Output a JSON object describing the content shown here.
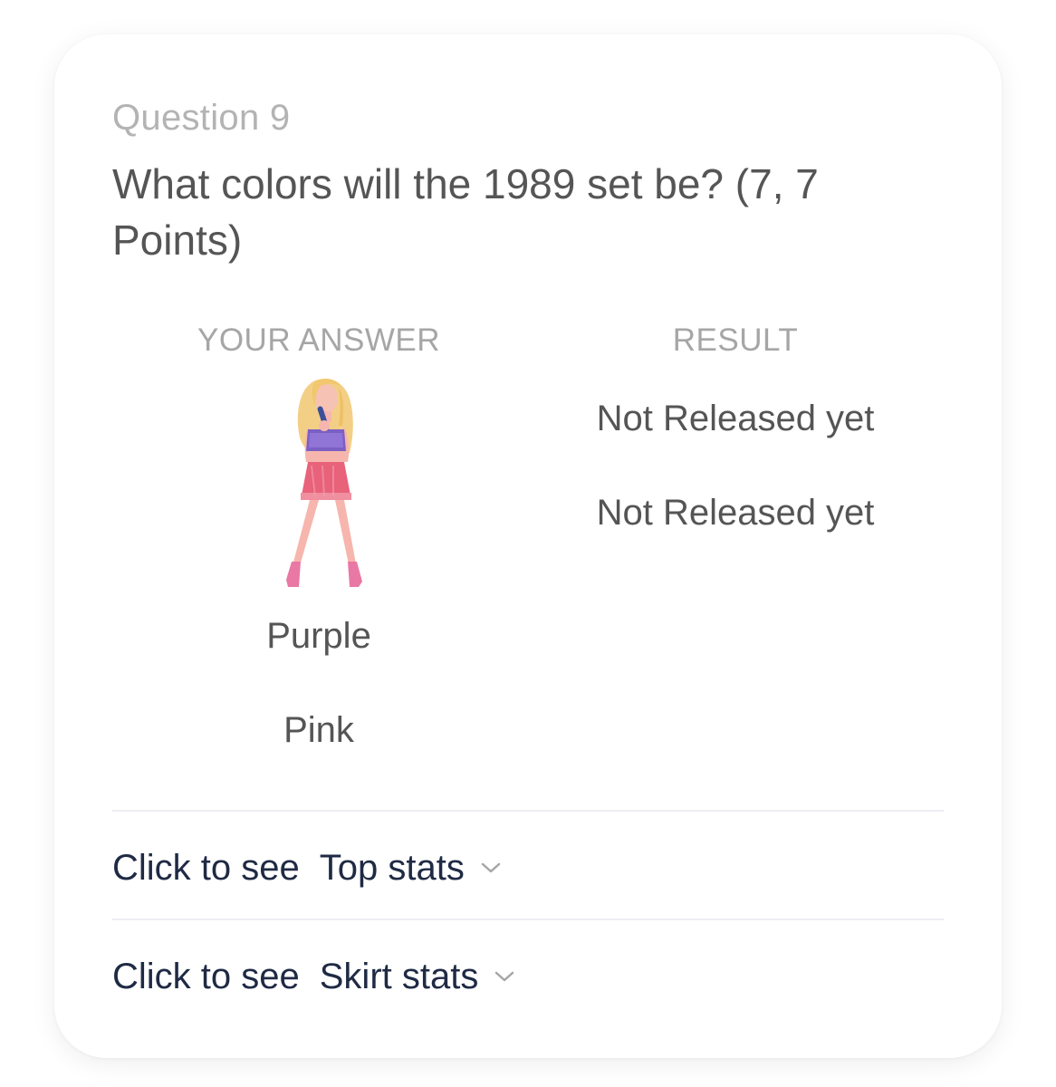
{
  "question": {
    "number_label": "Question 9",
    "text": "What colors will the 1989 set be? (7, 7 Points)"
  },
  "columns": {
    "answer_header": "YOUR ANSWER",
    "result_header": "RESULT"
  },
  "answers": [
    "Purple",
    "Pink"
  ],
  "results": [
    "Not Released yet",
    "Not Released yet"
  ],
  "stats": [
    {
      "prefix": "Click to see",
      "label": "Top stats",
      "icon": "chevron-down-icon"
    },
    {
      "prefix": "Click to see",
      "label": "Skirt stats",
      "icon": "chevron-down-icon"
    }
  ],
  "colors": {
    "top": "#7b5fc4",
    "skirt": "#e8627a",
    "hair": "#f3cf86",
    "skin": "#f6b6ad",
    "boots": "#e978a4",
    "link_text": "#1f2a44"
  }
}
